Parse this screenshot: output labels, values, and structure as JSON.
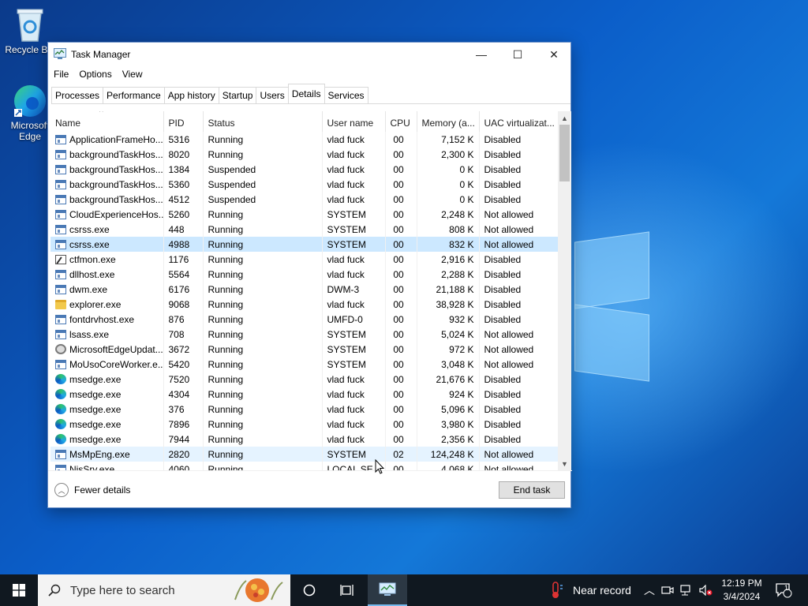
{
  "desktop": {
    "icons": [
      {
        "label": "Recycle Bin"
      },
      {
        "label": "Microsoft Edge"
      }
    ]
  },
  "window": {
    "title": "Task Manager",
    "minimize_glyph": "—",
    "maximize_glyph": "☐",
    "close_glyph": "✕",
    "menu": [
      "File",
      "Options",
      "View"
    ],
    "tabs": [
      "Processes",
      "Performance",
      "App history",
      "Startup",
      "Users",
      "Details",
      "Services"
    ],
    "active_tab": "Details"
  },
  "details": {
    "columns": [
      "Name",
      "PID",
      "Status",
      "User name",
      "CPU",
      "Memory (a...",
      "UAC virtualizat..."
    ],
    "rows": [
      {
        "icon": "generic",
        "name": "ApplicationFrameHo...",
        "pid": "5316",
        "status": "Running",
        "user": "vlad fuck",
        "cpu": "00",
        "memory": "7,152 K",
        "uac": "Disabled"
      },
      {
        "icon": "generic",
        "name": "backgroundTaskHos...",
        "pid": "8020",
        "status": "Running",
        "user": "vlad fuck",
        "cpu": "00",
        "memory": "2,300 K",
        "uac": "Disabled"
      },
      {
        "icon": "generic",
        "name": "backgroundTaskHos...",
        "pid": "1384",
        "status": "Suspended",
        "user": "vlad fuck",
        "cpu": "00",
        "memory": "0 K",
        "uac": "Disabled"
      },
      {
        "icon": "generic",
        "name": "backgroundTaskHos...",
        "pid": "5360",
        "status": "Suspended",
        "user": "vlad fuck",
        "cpu": "00",
        "memory": "0 K",
        "uac": "Disabled"
      },
      {
        "icon": "generic",
        "name": "backgroundTaskHos...",
        "pid": "4512",
        "status": "Suspended",
        "user": "vlad fuck",
        "cpu": "00",
        "memory": "0 K",
        "uac": "Disabled"
      },
      {
        "icon": "generic",
        "name": "CloudExperienceHos...",
        "pid": "5260",
        "status": "Running",
        "user": "SYSTEM",
        "cpu": "00",
        "memory": "2,248 K",
        "uac": "Not allowed"
      },
      {
        "icon": "generic",
        "name": "csrss.exe",
        "pid": "448",
        "status": "Running",
        "user": "SYSTEM",
        "cpu": "00",
        "memory": "808 K",
        "uac": "Not allowed"
      },
      {
        "icon": "generic",
        "name": "csrss.exe",
        "pid": "4988",
        "status": "Running",
        "user": "SYSTEM",
        "cpu": "00",
        "memory": "832 K",
        "uac": "Not allowed",
        "selected": true
      },
      {
        "icon": "ctf",
        "name": "ctfmon.exe",
        "pid": "1176",
        "status": "Running",
        "user": "vlad fuck",
        "cpu": "00",
        "memory": "2,916 K",
        "uac": "Disabled"
      },
      {
        "icon": "generic",
        "name": "dllhost.exe",
        "pid": "5564",
        "status": "Running",
        "user": "vlad fuck",
        "cpu": "00",
        "memory": "2,288 K",
        "uac": "Disabled"
      },
      {
        "icon": "generic",
        "name": "dwm.exe",
        "pid": "6176",
        "status": "Running",
        "user": "DWM-3",
        "cpu": "00",
        "memory": "21,188 K",
        "uac": "Disabled"
      },
      {
        "icon": "folder",
        "name": "explorer.exe",
        "pid": "9068",
        "status": "Running",
        "user": "vlad fuck",
        "cpu": "00",
        "memory": "38,928 K",
        "uac": "Disabled"
      },
      {
        "icon": "generic",
        "name": "fontdrvhost.exe",
        "pid": "876",
        "status": "Running",
        "user": "UMFD-0",
        "cpu": "00",
        "memory": "932 K",
        "uac": "Disabled"
      },
      {
        "icon": "generic",
        "name": "lsass.exe",
        "pid": "708",
        "status": "Running",
        "user": "SYSTEM",
        "cpu": "00",
        "memory": "5,024 K",
        "uac": "Not allowed"
      },
      {
        "icon": "gear",
        "name": "MicrosoftEdgeUpdat...",
        "pid": "3672",
        "status": "Running",
        "user": "SYSTEM",
        "cpu": "00",
        "memory": "972 K",
        "uac": "Not allowed"
      },
      {
        "icon": "generic",
        "name": "MoUsoCoreWorker.e...",
        "pid": "5420",
        "status": "Running",
        "user": "SYSTEM",
        "cpu": "00",
        "memory": "3,048 K",
        "uac": "Not allowed"
      },
      {
        "icon": "edge",
        "name": "msedge.exe",
        "pid": "7520",
        "status": "Running",
        "user": "vlad fuck",
        "cpu": "00",
        "memory": "21,676 K",
        "uac": "Disabled"
      },
      {
        "icon": "edge",
        "name": "msedge.exe",
        "pid": "4304",
        "status": "Running",
        "user": "vlad fuck",
        "cpu": "00",
        "memory": "924 K",
        "uac": "Disabled"
      },
      {
        "icon": "edge",
        "name": "msedge.exe",
        "pid": "376",
        "status": "Running",
        "user": "vlad fuck",
        "cpu": "00",
        "memory": "5,096 K",
        "uac": "Disabled"
      },
      {
        "icon": "edge",
        "name": "msedge.exe",
        "pid": "7896",
        "status": "Running",
        "user": "vlad fuck",
        "cpu": "00",
        "memory": "3,980 K",
        "uac": "Disabled"
      },
      {
        "icon": "edge",
        "name": "msedge.exe",
        "pid": "7944",
        "status": "Running",
        "user": "vlad fuck",
        "cpu": "00",
        "memory": "2,356 K",
        "uac": "Disabled"
      },
      {
        "icon": "generic",
        "name": "MsMpEng.exe",
        "pid": "2820",
        "status": "Running",
        "user": "SYSTEM",
        "cpu": "02",
        "memory": "124,248 K",
        "uac": "Not allowed",
        "hovered": true
      },
      {
        "icon": "generic",
        "name": "NisSrv.exe",
        "pid": "4060",
        "status": "Running",
        "user": "LOCAL SE...",
        "cpu": "00",
        "memory": "4,068 K",
        "uac": "Not allowed"
      }
    ]
  },
  "footer": {
    "fewer_details": "Fewer details",
    "end_task": "End task"
  },
  "taskbar": {
    "search_placeholder": "Type here to search",
    "weather_text": "Near record",
    "time": "12:19 PM",
    "date": "3/4/2024",
    "notification_count": "1"
  },
  "colors": {
    "selected_row": "#cce8ff",
    "hover_row": "#e5f3ff",
    "taskbar": "#101820"
  }
}
